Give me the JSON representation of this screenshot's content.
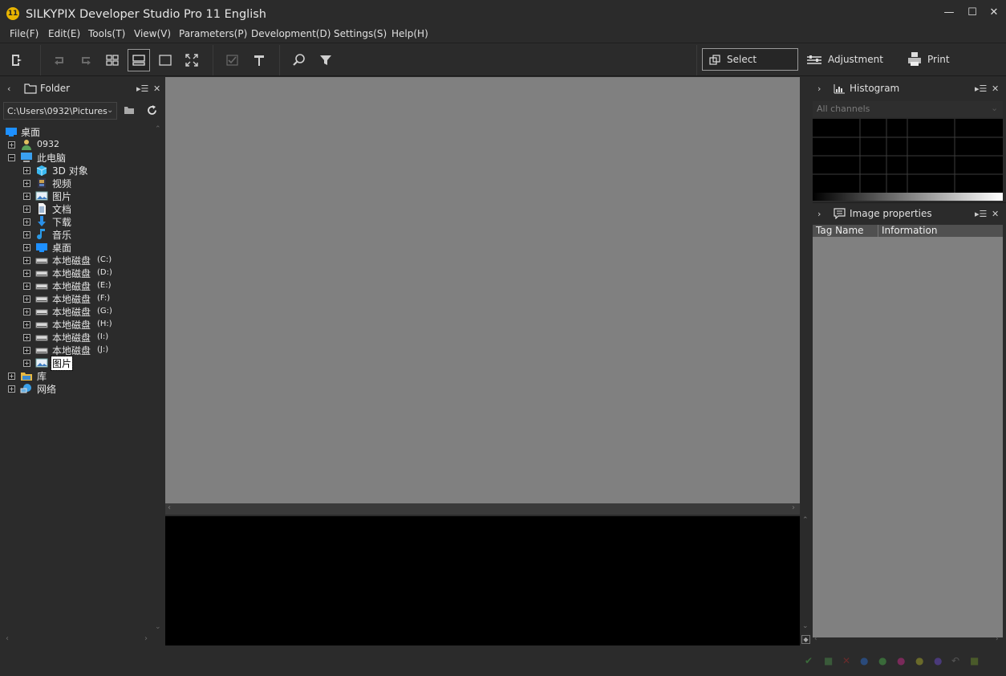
{
  "window": {
    "title": "SILKYPIX Developer Studio Pro 11 English",
    "logo_text": "11",
    "minimize": "—",
    "maximize": "☐",
    "close": "✕"
  },
  "menu": [
    {
      "label": "File(F)"
    },
    {
      "label": "Edit(E)"
    },
    {
      "label": "Tools(T)"
    },
    {
      "label": "View(V)"
    },
    {
      "label": "Parameters(P)"
    },
    {
      "label": "Development(D)"
    },
    {
      "label": "Settings(S)"
    },
    {
      "label": "Help(H)"
    }
  ],
  "toolbar": {
    "icons": [
      "export-icon",
      "undo-icon",
      "redo-icon",
      "grid-view-icon",
      "preview-filmstrip-icon",
      "single-view-icon",
      "fullscreen-icon",
      "check-icon",
      "hammer-icon",
      "search-zoom-icon",
      "filter-icon"
    ],
    "modes": {
      "select": "Select",
      "adjustment": "Adjustment",
      "print": "Print"
    }
  },
  "folder_panel": {
    "title": "Folder",
    "path": "C:\\Users\\0932\\Pictures",
    "tree": [
      {
        "label": "桌面",
        "icon": "desktop-icon",
        "expander": "",
        "level": 0
      },
      {
        "label": "0932",
        "icon": "user-icon",
        "expander": "+",
        "level": 0
      },
      {
        "label": "此电脑",
        "icon": "computer-icon",
        "expander": "−",
        "level": 0
      },
      {
        "label": "3D 对象",
        "icon": "3d-objects-icon",
        "expander": "+",
        "level": 1
      },
      {
        "label": "视频",
        "icon": "video-icon",
        "expander": "+",
        "level": 1
      },
      {
        "label": "图片",
        "icon": "pictures-icon",
        "expander": "+",
        "level": 1
      },
      {
        "label": "文档",
        "icon": "document-icon",
        "expander": "+",
        "level": 1
      },
      {
        "label": "下载",
        "icon": "download-icon",
        "expander": "+",
        "level": 1
      },
      {
        "label": "音乐",
        "icon": "music-icon",
        "expander": "+",
        "level": 1
      },
      {
        "label": "桌面",
        "icon": "desktop-icon",
        "expander": "+",
        "level": 1
      },
      {
        "label": "本地磁盘",
        "drive": "(C:)",
        "icon": "drive-icon",
        "expander": "+",
        "level": 1
      },
      {
        "label": "本地磁盘",
        "drive": "(D:)",
        "icon": "drive-icon",
        "expander": "+",
        "level": 1
      },
      {
        "label": "本地磁盘",
        "drive": "(E:)",
        "icon": "drive-icon",
        "expander": "+",
        "level": 1
      },
      {
        "label": "本地磁盘",
        "drive": "(F:)",
        "icon": "drive-icon",
        "expander": "+",
        "level": 1
      },
      {
        "label": "本地磁盘",
        "drive": "(G:)",
        "icon": "drive-icon",
        "expander": "+",
        "level": 1
      },
      {
        "label": "本地磁盘",
        "drive": "(H:)",
        "icon": "drive-icon",
        "expander": "+",
        "level": 1
      },
      {
        "label": "本地磁盘",
        "drive": "(I:)",
        "icon": "drive-icon",
        "expander": "+",
        "level": 1
      },
      {
        "label": "本地磁盘",
        "drive": "(J:)",
        "icon": "drive-icon",
        "expander": "+",
        "level": 1
      },
      {
        "label": "图片",
        "icon": "pictures-icon",
        "expander": "+",
        "level": 1,
        "selected": true
      },
      {
        "label": "库",
        "icon": "library-icon",
        "expander": "+",
        "level": 0
      },
      {
        "label": "网络",
        "icon": "network-icon",
        "expander": "+",
        "level": 0
      }
    ]
  },
  "histogram_panel": {
    "title": "Histogram",
    "channel_placeholder": "All channels"
  },
  "properties_panel": {
    "title": "Image properties",
    "columns": [
      "Tag Name",
      "Information"
    ]
  },
  "colors": {
    "background": "#2b2b2b",
    "preview": "#808080",
    "filmstrip": "#000000",
    "selection": "#0078d7"
  }
}
